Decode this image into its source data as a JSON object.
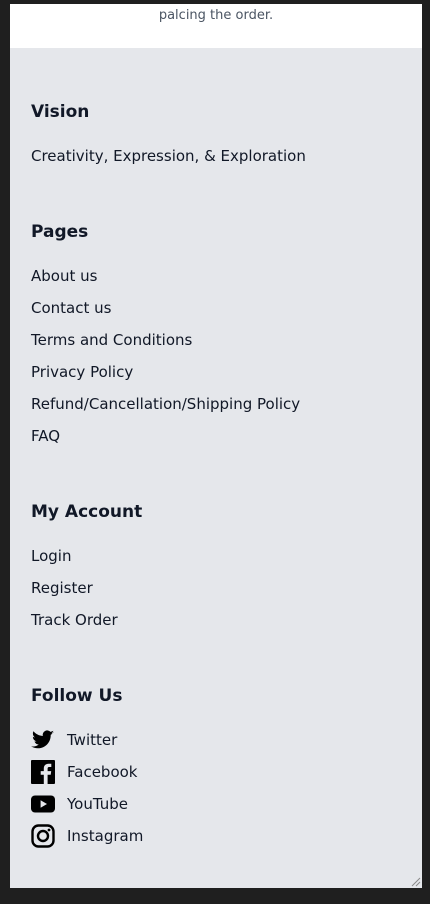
{
  "top_note": "palcing the order.",
  "vision": {
    "heading": "Vision",
    "text": "Creativity, Expression, & Exploration"
  },
  "pages": {
    "heading": "Pages",
    "items": [
      "About us",
      "Contact us",
      "Terms and Conditions",
      "Privacy Policy",
      "Refund/Cancellation/Shipping Policy",
      "FAQ"
    ]
  },
  "account": {
    "heading": "My Account",
    "items": [
      "Login",
      "Register",
      "Track Order"
    ]
  },
  "follow": {
    "heading": "Follow Us",
    "items": [
      {
        "label": "Twitter",
        "icon": "twitter-icon"
      },
      {
        "label": "Facebook",
        "icon": "facebook-icon"
      },
      {
        "label": "YouTube",
        "icon": "youtube-icon"
      },
      {
        "label": "Instagram",
        "icon": "instagram-icon"
      }
    ]
  },
  "colors": {
    "footer_bg": "#e5e7eb",
    "text": "#111827",
    "page_bg": "#1f1f1f"
  }
}
